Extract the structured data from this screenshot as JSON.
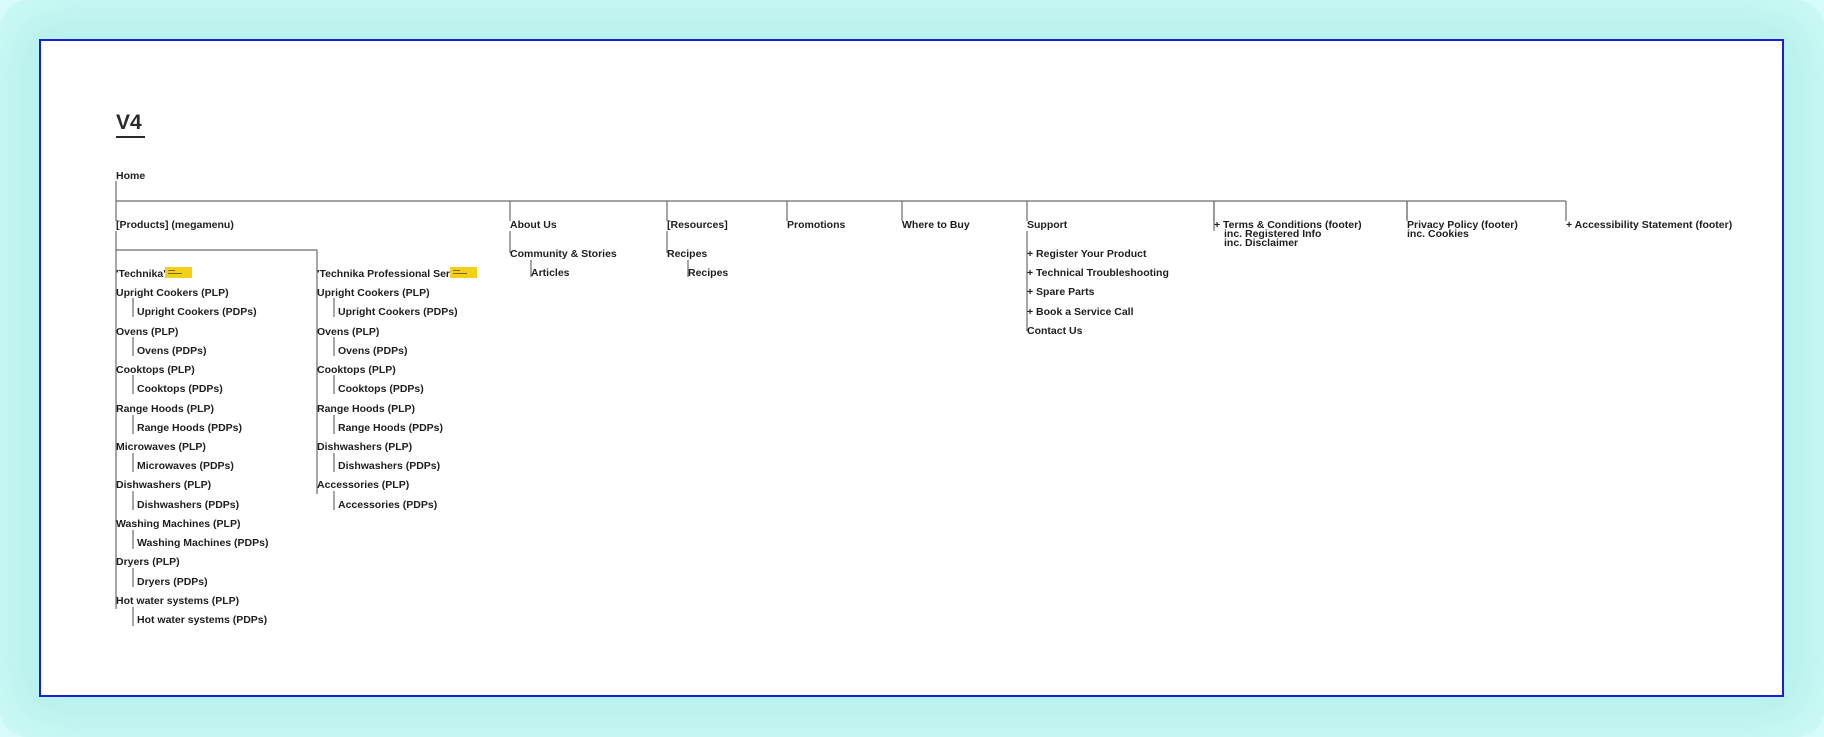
{
  "diagram": {
    "title": "V4",
    "colors": {
      "line": "#6b6b6b",
      "border": "#1a1fcf",
      "note": "#f3ce1a",
      "text": "#1e1e1e"
    },
    "root": "Home",
    "top_level": [
      "[Products] (megamenu)",
      "About Us",
      "[Resources]",
      "Promotions",
      "Where to Buy",
      "Support",
      "+ Terms & Conditions (footer)",
      "Privacy Policy (footer)",
      "+ Accessibility Statement (footer)"
    ],
    "terms_sub": [
      "inc. Registered Info",
      "inc. Disclaimer"
    ],
    "privacy_sub": [
      "inc. Cookies"
    ],
    "technika": {
      "name": "'Technika'",
      "items": [
        [
          "Upright Cookers (PLP)",
          "Upright Cookers (PDPs)"
        ],
        [
          "Ovens (PLP)",
          "Ovens (PDPs)"
        ],
        [
          "Cooktops (PLP)",
          "Cooktops (PDPs)"
        ],
        [
          "Range Hoods (PLP)",
          "Range Hoods (PDPs)"
        ],
        [
          "Microwaves (PLP)",
          "Microwaves (PDPs)"
        ],
        [
          "Dishwashers (PLP)",
          "Dishwashers (PDPs)"
        ],
        [
          "Washing Machines (PLP)",
          "Washing Machines (PDPs)"
        ],
        [
          "Dryers (PLP)",
          "Dryers (PDPs)"
        ],
        [
          "Hot water systems (PLP)",
          "Hot water systems (PDPs)"
        ]
      ]
    },
    "professional": {
      "name": "'Technika Professional Series'",
      "items": [
        [
          "Upright Cookers (PLP)",
          "Upright Cookers (PDPs)"
        ],
        [
          "Ovens (PLP)",
          "Ovens (PDPs)"
        ],
        [
          "Cooktops (PLP)",
          "Cooktops (PDPs)"
        ],
        [
          "Range Hoods (PLP)",
          "Range Hoods (PDPs)"
        ],
        [
          "Dishwashers (PLP)",
          "Dishwashers (PDPs)"
        ],
        [
          "Accessories (PLP)",
          "Accessories (PDPs)"
        ]
      ]
    },
    "about": [
      "Community & Stories",
      "Articles"
    ],
    "resources": [
      "Recipes",
      "Recipes"
    ],
    "support": [
      "+ Register Your Product",
      "+ Technical Troubleshooting",
      "+ Spare Parts",
      "+ Book a Service Call",
      "Contact Us"
    ]
  }
}
